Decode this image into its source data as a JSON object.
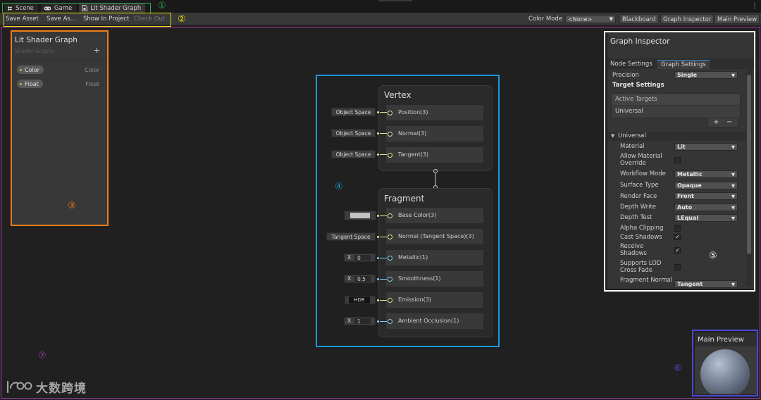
{
  "window_tabs": [
    {
      "label": "Scene",
      "icon": "scene-grid-icon"
    },
    {
      "label": "Game",
      "icon": "gamepad-icon"
    },
    {
      "label": "Lit Shader Graph",
      "icon": "shader-graph-icon",
      "active": true
    }
  ],
  "toolbar": {
    "save_asset": "Save Asset",
    "save_as": "Save As...",
    "show_in_project": "Show In Project",
    "check_out": "Check Out",
    "color_mode_label": "Color Mode",
    "color_mode_value": "<None>",
    "blackboard": "Blackboard",
    "graph_inspector": "Graph Inspector",
    "main_preview": "Main Preview"
  },
  "annotations": {
    "n1": "①",
    "n2": "②",
    "n3": "③",
    "n4": "④",
    "n5": "⑤",
    "n6": "⑥",
    "n7": "⑦"
  },
  "annotation_colors": {
    "n1": "#2fb04a",
    "n2": "#e8e200",
    "n3": "#f07b1d",
    "n4": "#1a98d6",
    "n5": "#ffffff",
    "n6": "#4a4ad8",
    "n7": "#a23aa8"
  },
  "blackboard": {
    "title": "Lit Shader Graph",
    "subtitle": "Shader Graphs",
    "add": "+",
    "properties": [
      {
        "name": "Color",
        "type": "Color"
      },
      {
        "name": "Float",
        "type": "Float"
      }
    ]
  },
  "vertex": {
    "title": "Vertex",
    "slots": [
      {
        "label": "Position(3)",
        "input": "Object Space"
      },
      {
        "label": "Normal(3)",
        "input": "Object Space"
      },
      {
        "label": "Tangent(3)",
        "input": "Object Space"
      }
    ]
  },
  "fragment": {
    "title": "Fragment",
    "base_color": "Base Color(3)",
    "normal": "Normal (Tangent Space)(3)",
    "normal_input": "Tangent Space",
    "metallic": "Metallic(1)",
    "metallic_x": "X",
    "metallic_value": "0",
    "smoothness": "Smoothness(1)",
    "smoothness_x": "X",
    "smoothness_value": "0.5",
    "emission": "Emission(3)",
    "emission_input": "HDR",
    "ao": "Ambient Occlusion(1)",
    "ao_x": "X",
    "ao_value": "1"
  },
  "inspector": {
    "title": "Graph Inspector",
    "tab_node": "Node Settings",
    "tab_graph": "Graph Settings",
    "precision_label": "Precision",
    "precision_value": "Single",
    "target_settings": "Target Settings",
    "active_targets": "Active Targets",
    "target_item": "Universal",
    "plus": "+",
    "minus": "−",
    "section": "Universal",
    "material_label": "Material",
    "material_value": "Lit",
    "allow_override_1": "Allow Material",
    "allow_override_2": "Override",
    "workflow_label": "Workflow Mode",
    "workflow_value": "Metallic",
    "surface_label": "Surface Type",
    "surface_value": "Opaque",
    "render_face_label": "Render Face",
    "render_face_value": "Front",
    "depth_write_label": "Depth Write",
    "depth_write_value": "Auto",
    "depth_test_label": "Depth Test",
    "depth_test_value": "LEqual",
    "alpha_clip": "Alpha Clipping",
    "cast_shadows": "Cast Shadows",
    "receive_shadows_1": "Receive",
    "receive_shadows_2": "Shadows",
    "lod_1": "Supports LOD",
    "lod_2": "Cross Fade",
    "frag_normal": "Fragment Normal",
    "frag_normal_value": "Tangent",
    "check": "✓"
  },
  "preview": {
    "title": "Main Preview"
  },
  "watermark": {
    "text": "大数跨境"
  }
}
